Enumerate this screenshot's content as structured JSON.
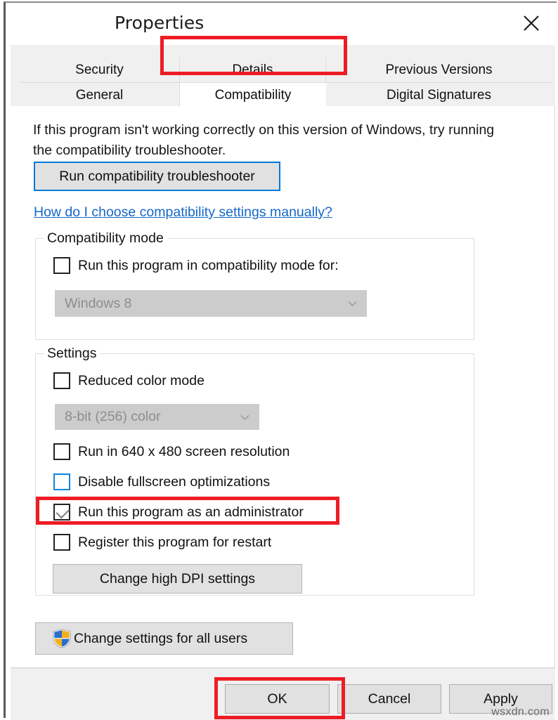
{
  "window": {
    "title": "Properties",
    "close_icon": "close-icon"
  },
  "tabs": {
    "row_top": [
      {
        "label": "Security",
        "active": false
      },
      {
        "label": "Details",
        "active": false
      },
      {
        "label": "Previous Versions",
        "active": false
      }
    ],
    "row_bottom": [
      {
        "label": "General",
        "active": false
      },
      {
        "label": "Compatibility",
        "active": true
      },
      {
        "label": "Digital Signatures",
        "active": false
      }
    ]
  },
  "content": {
    "intro_text": "If this program isn't working correctly on this version of Windows, try running the compatibility troubleshooter.",
    "troubleshooter_button": "Run compatibility troubleshooter",
    "help_link": "How do I choose compatibility settings manually?"
  },
  "compatibility_mode": {
    "group_title": "Compatibility mode",
    "checkbox_label": "Run this program in compatibility mode for:",
    "checkbox_checked": false,
    "combo_value": "Windows 8",
    "combo_disabled": true
  },
  "settings": {
    "group_title": "Settings",
    "reduced_color_label": "Reduced color mode",
    "reduced_color_checked": false,
    "color_depth_value": "8-bit (256) color",
    "color_depth_disabled": true,
    "items": [
      {
        "label": "Run in 640 x 480 screen resolution",
        "checked": false,
        "focused": false
      },
      {
        "label": "Disable fullscreen optimizations",
        "checked": false,
        "focused": true
      },
      {
        "label": "Run this program as an administrator",
        "checked": true,
        "focused": false
      },
      {
        "label": "Register this program for restart",
        "checked": false,
        "focused": false
      }
    ],
    "dpi_button": "Change high DPI settings"
  },
  "all_users": {
    "button_label": "Change settings for all users",
    "icon": "uac-shield-icon"
  },
  "dialog_buttons": {
    "ok": "OK",
    "cancel": "Cancel",
    "apply": "Apply"
  },
  "watermark": "wsxdn.com",
  "colors": {
    "highlight_red": "#ee1c25",
    "accent_blue": "#0078d7",
    "link_blue": "#1668c8",
    "disabled_grey": "#cccccc",
    "button_face": "#e1e1e1",
    "tab_strip": "#f0f0f0"
  }
}
